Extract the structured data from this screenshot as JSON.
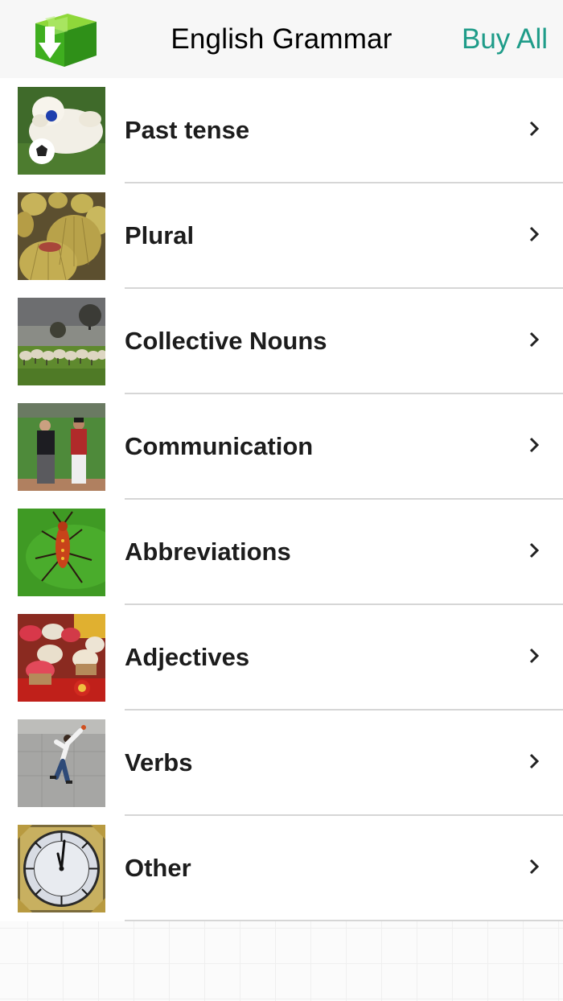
{
  "nav": {
    "title": "English Grammar",
    "buy_all_label": "Buy All",
    "logo_icon": "green-box-download-icon"
  },
  "items": [
    {
      "label": "Past tense",
      "thumbnail": "dog-with-ball-photo"
    },
    {
      "label": "Plural",
      "thumbnail": "cacti-photo"
    },
    {
      "label": "Collective Nouns",
      "thumbnail": "sheep-flock-photo"
    },
    {
      "label": "Communication",
      "thumbnail": "baseball-umpire-photo"
    },
    {
      "label": "Abbreviations",
      "thumbnail": "insect-on-leaf-photo"
    },
    {
      "label": "Adjectives",
      "thumbnail": "cupcakes-photo"
    },
    {
      "label": "Verbs",
      "thumbnail": "person-jumping-photo"
    },
    {
      "label": "Other",
      "thumbnail": "clock-face-photo"
    }
  ],
  "colors": {
    "accent": "#1f9c89",
    "nav_background": "#f7f7f7",
    "separator": "#d6d6d6"
  },
  "row_chevron_icon": "chevron-right-icon"
}
